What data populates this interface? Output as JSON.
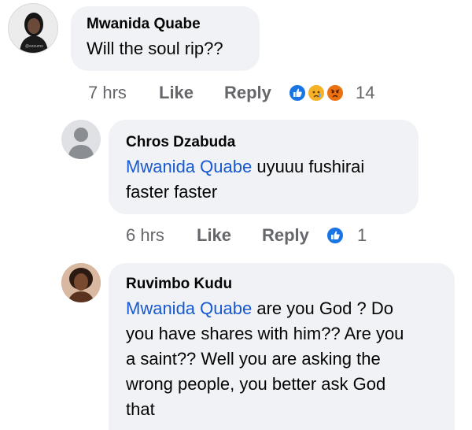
{
  "comments": [
    {
      "author": "Mwanida Quabe",
      "text": "Will the soul rip??",
      "time": "7 hrs",
      "like_label": "Like",
      "reply_label": "Reply",
      "reaction_count": "14",
      "reactions": [
        "like-icon",
        "sad-icon",
        "angry-icon"
      ],
      "avatar_caption": "@ezeumo"
    },
    {
      "author": "Chros Dzabuda",
      "mention": "Mwanida Quabe",
      "text_line1": " uyuuu fushirai",
      "text_line2": "faster faster",
      "time": "6 hrs",
      "like_label": "Like",
      "reply_label": "Reply",
      "reaction_count": "1",
      "reactions": [
        "like-icon"
      ]
    },
    {
      "author": "Ruvimbo Kudu",
      "mention": "Mwanida Quabe",
      "text_line1": " are you God ? Do",
      "text_line2": "you have shares with him?? Are you",
      "text_line3": "a saint?? Well you are asking the",
      "text_line4": "wrong people, you better ask God",
      "text_line5": "that"
    }
  ],
  "colors": {
    "bubble": "#f0f2f5",
    "mention": "#1659d1",
    "meta": "#65676b",
    "like_blue": "#1b74e4",
    "angry": "#e9710f",
    "sad": "#f7b125"
  }
}
